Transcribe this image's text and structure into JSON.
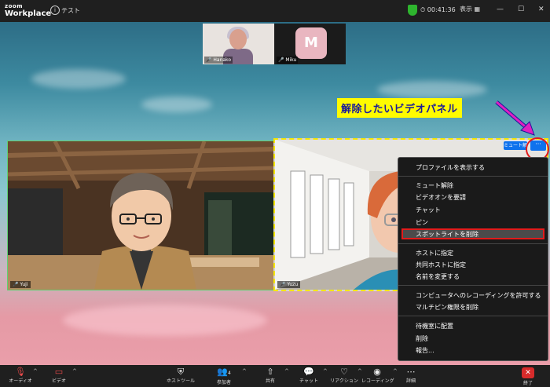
{
  "titlebar": {
    "logo_top": "zoom",
    "logo_bottom": "Workplace",
    "meeting_name": "テスト",
    "timer": "00:41:36",
    "view_label": "表示"
  },
  "thumbnails": [
    {
      "name": "Hanako"
    },
    {
      "name": "Miku",
      "initial": "M"
    }
  ],
  "annotation": {
    "text": "解除したいビデオパネル"
  },
  "panels": {
    "left": {
      "name": "Yuji"
    },
    "right": {
      "name": "Yuzu"
    }
  },
  "panel_controls": {
    "mute_label": "ミュート解",
    "more_label": "···"
  },
  "context_menu": {
    "items": [
      "プロファイルを表示する",
      "ミュート解除",
      "ビデオオンを要請",
      "チャット",
      "ピン",
      "スポットライトを削除",
      "ホストに指定",
      "共同ホストに指定",
      "名前を変更する",
      "コンピュータへのレコーディングを許可する",
      "マルチピン権限を削除",
      "待機室に配置",
      "削除",
      "報告..."
    ],
    "highlighted": "スポットライトを削除"
  },
  "toolbar": {
    "audio": "オーディオ",
    "video": "ビデオ",
    "host_tools": "ホストツール",
    "participants": "参加者",
    "participants_count": "4",
    "share": "共有",
    "chat": "チャット",
    "reactions": "リアクション",
    "recording": "レコーディング",
    "more": "詳細",
    "end": "終了"
  },
  "colors": {
    "accent_blue": "#0e72ed",
    "highlight_red": "#e21b1b",
    "annotation_yellow": "#fffb00",
    "active_border": "#5fd16f"
  }
}
